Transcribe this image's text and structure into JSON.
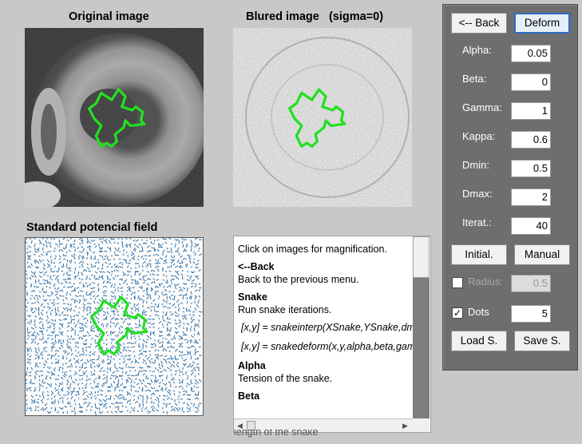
{
  "titles": {
    "original": "Original image",
    "blurred": "Blured image   (sigma=0)",
    "potential": "Standard potencial field"
  },
  "help": {
    "intro": "Click on images for magnification.",
    "back_heading": "<--Back",
    "back_desc": "Back to the previous menu.",
    "snake_heading": "Snake",
    "snake_desc": "Run snake iterations.",
    "code1": "[x,y] = snakeinterp(XSnake,YSnake,dmax,",
    "code2": "[x,y] = snakedeform(x,y,alpha,beta,gamma",
    "alpha_heading": "Alpha",
    "alpha_desc": "Tension of the snake.",
    "beta_heading": "Beta"
  },
  "below_panel_text": "length of the snake",
  "controls": {
    "back_button": "<-- Back",
    "deform_button": "Deform",
    "params": [
      {
        "label": "Alpha:",
        "value": "0.05"
      },
      {
        "label": "Beta:",
        "value": "0"
      },
      {
        "label": "Gamma:",
        "value": "1"
      },
      {
        "label": "Kappa:",
        "value": "0.6"
      },
      {
        "label": "Dmin:",
        "value": "0.5"
      },
      {
        "label": "Dmax:",
        "value": "2"
      },
      {
        "label": "Iterat.:",
        "value": "40"
      }
    ],
    "initial_button": "Initial.",
    "manual_button": "Manual",
    "radius": {
      "label": "Radius:",
      "value": "0.5",
      "checked": false
    },
    "dots": {
      "label": "Dots",
      "value": "5",
      "checked": true
    },
    "load_button": "Load S.",
    "save_button": "Save S."
  },
  "colors": {
    "snake": "#22e022",
    "arrows": "#2a6fa8",
    "panel": "#6e6e6e",
    "selected_border": "#2b6cc4"
  }
}
